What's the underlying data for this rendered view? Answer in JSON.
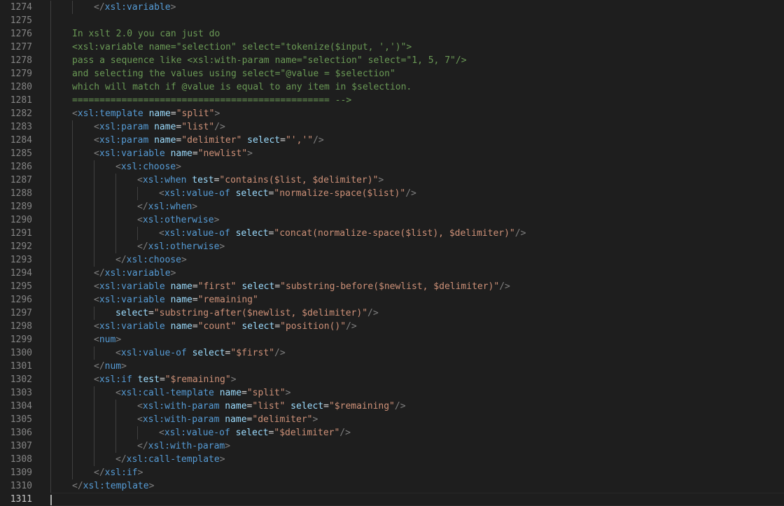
{
  "editor": {
    "lines": [
      {
        "n": "1274",
        "indent": 2,
        "tokens": [
          {
            "t": "</",
            "c": "bracket"
          },
          {
            "t": "xsl:variable",
            "c": "tag"
          },
          {
            "t": ">",
            "c": "bracket"
          }
        ]
      },
      {
        "n": "1275",
        "indent": 0,
        "tokens": []
      },
      {
        "n": "1276",
        "indent": 1,
        "tokens": [
          {
            "t": "In xslt 2.0 you can just do",
            "c": "comment"
          }
        ]
      },
      {
        "n": "1277",
        "indent": 1,
        "tokens": [
          {
            "t": "<xsl:variable name=\"selection\" select=\"tokenize($input, ',')\">",
            "c": "comment"
          }
        ]
      },
      {
        "n": "1278",
        "indent": 1,
        "tokens": [
          {
            "t": "pass a sequence like <xsl:with-param name=\"selection\" select=\"1, 5, 7\"/>",
            "c": "comment"
          }
        ]
      },
      {
        "n": "1279",
        "indent": 1,
        "tokens": [
          {
            "t": "and selecting the values using select=\"@value = $selection\"",
            "c": "comment"
          }
        ]
      },
      {
        "n": "1280",
        "indent": 1,
        "tokens": [
          {
            "t": "which will match if @value is equal to any item in $selection.",
            "c": "comment"
          }
        ]
      },
      {
        "n": "1281",
        "indent": 1,
        "tokens": [
          {
            "t": "=============================================== -->",
            "c": "comment"
          }
        ]
      },
      {
        "n": "1282",
        "indent": 1,
        "tokens": [
          {
            "t": "<",
            "c": "bracket"
          },
          {
            "t": "xsl:template",
            "c": "tag"
          },
          {
            "t": " ",
            "c": "text"
          },
          {
            "t": "name",
            "c": "attr"
          },
          {
            "t": "=",
            "c": "eq"
          },
          {
            "t": "\"split\"",
            "c": "str"
          },
          {
            "t": ">",
            "c": "bracket"
          }
        ]
      },
      {
        "n": "1283",
        "indent": 2,
        "tokens": [
          {
            "t": "<",
            "c": "bracket"
          },
          {
            "t": "xsl:param",
            "c": "tag"
          },
          {
            "t": " ",
            "c": "text"
          },
          {
            "t": "name",
            "c": "attr"
          },
          {
            "t": "=",
            "c": "eq"
          },
          {
            "t": "\"list\"",
            "c": "str"
          },
          {
            "t": "/>",
            "c": "bracket"
          }
        ]
      },
      {
        "n": "1284",
        "indent": 2,
        "tokens": [
          {
            "t": "<",
            "c": "bracket"
          },
          {
            "t": "xsl:param",
            "c": "tag"
          },
          {
            "t": " ",
            "c": "text"
          },
          {
            "t": "name",
            "c": "attr"
          },
          {
            "t": "=",
            "c": "eq"
          },
          {
            "t": "\"delimiter\"",
            "c": "str"
          },
          {
            "t": " ",
            "c": "text"
          },
          {
            "t": "select",
            "c": "attr"
          },
          {
            "t": "=",
            "c": "eq"
          },
          {
            "t": "\"','\"",
            "c": "str"
          },
          {
            "t": "/>",
            "c": "bracket"
          }
        ]
      },
      {
        "n": "1285",
        "indent": 2,
        "tokens": [
          {
            "t": "<",
            "c": "bracket"
          },
          {
            "t": "xsl:variable",
            "c": "tag"
          },
          {
            "t": " ",
            "c": "text"
          },
          {
            "t": "name",
            "c": "attr"
          },
          {
            "t": "=",
            "c": "eq"
          },
          {
            "t": "\"newlist\"",
            "c": "str"
          },
          {
            "t": ">",
            "c": "bracket"
          }
        ]
      },
      {
        "n": "1286",
        "indent": 3,
        "tokens": [
          {
            "t": "<",
            "c": "bracket"
          },
          {
            "t": "xsl:choose",
            "c": "tag"
          },
          {
            "t": ">",
            "c": "bracket"
          }
        ]
      },
      {
        "n": "1287",
        "indent": 4,
        "tokens": [
          {
            "t": "<",
            "c": "bracket"
          },
          {
            "t": "xsl:when",
            "c": "tag"
          },
          {
            "t": " ",
            "c": "text"
          },
          {
            "t": "test",
            "c": "attr"
          },
          {
            "t": "=",
            "c": "eq"
          },
          {
            "t": "\"contains($list, $delimiter)\"",
            "c": "str"
          },
          {
            "t": ">",
            "c": "bracket"
          }
        ]
      },
      {
        "n": "1288",
        "indent": 5,
        "tokens": [
          {
            "t": "<",
            "c": "bracket"
          },
          {
            "t": "xsl:value-of",
            "c": "tag"
          },
          {
            "t": " ",
            "c": "text"
          },
          {
            "t": "select",
            "c": "attr"
          },
          {
            "t": "=",
            "c": "eq"
          },
          {
            "t": "\"normalize-space($list)\"",
            "c": "str"
          },
          {
            "t": "/>",
            "c": "bracket"
          }
        ]
      },
      {
        "n": "1289",
        "indent": 4,
        "tokens": [
          {
            "t": "</",
            "c": "bracket"
          },
          {
            "t": "xsl:when",
            "c": "tag"
          },
          {
            "t": ">",
            "c": "bracket"
          }
        ]
      },
      {
        "n": "1290",
        "indent": 4,
        "tokens": [
          {
            "t": "<",
            "c": "bracket"
          },
          {
            "t": "xsl:otherwise",
            "c": "tag"
          },
          {
            "t": ">",
            "c": "bracket"
          }
        ]
      },
      {
        "n": "1291",
        "indent": 5,
        "tokens": [
          {
            "t": "<",
            "c": "bracket"
          },
          {
            "t": "xsl:value-of",
            "c": "tag"
          },
          {
            "t": " ",
            "c": "text"
          },
          {
            "t": "select",
            "c": "attr"
          },
          {
            "t": "=",
            "c": "eq"
          },
          {
            "t": "\"concat(normalize-space($list), $delimiter)\"",
            "c": "str"
          },
          {
            "t": "/>",
            "c": "bracket"
          }
        ]
      },
      {
        "n": "1292",
        "indent": 4,
        "tokens": [
          {
            "t": "</",
            "c": "bracket"
          },
          {
            "t": "xsl:otherwise",
            "c": "tag"
          },
          {
            "t": ">",
            "c": "bracket"
          }
        ]
      },
      {
        "n": "1293",
        "indent": 3,
        "tokens": [
          {
            "t": "</",
            "c": "bracket"
          },
          {
            "t": "xsl:choose",
            "c": "tag"
          },
          {
            "t": ">",
            "c": "bracket"
          }
        ]
      },
      {
        "n": "1294",
        "indent": 2,
        "tokens": [
          {
            "t": "</",
            "c": "bracket"
          },
          {
            "t": "xsl:variable",
            "c": "tag"
          },
          {
            "t": ">",
            "c": "bracket"
          }
        ]
      },
      {
        "n": "1295",
        "indent": 2,
        "tokens": [
          {
            "t": "<",
            "c": "bracket"
          },
          {
            "t": "xsl:variable",
            "c": "tag"
          },
          {
            "t": " ",
            "c": "text"
          },
          {
            "t": "name",
            "c": "attr"
          },
          {
            "t": "=",
            "c": "eq"
          },
          {
            "t": "\"first\"",
            "c": "str"
          },
          {
            "t": " ",
            "c": "text"
          },
          {
            "t": "select",
            "c": "attr"
          },
          {
            "t": "=",
            "c": "eq"
          },
          {
            "t": "\"substring-before($newlist, $delimiter)\"",
            "c": "str"
          },
          {
            "t": "/>",
            "c": "bracket"
          }
        ]
      },
      {
        "n": "1296",
        "indent": 2,
        "tokens": [
          {
            "t": "<",
            "c": "bracket"
          },
          {
            "t": "xsl:variable",
            "c": "tag"
          },
          {
            "t": " ",
            "c": "text"
          },
          {
            "t": "name",
            "c": "attr"
          },
          {
            "t": "=",
            "c": "eq"
          },
          {
            "t": "\"remaining\"",
            "c": "str"
          }
        ]
      },
      {
        "n": "1297",
        "indent": 3,
        "tokens": [
          {
            "t": "select",
            "c": "attr"
          },
          {
            "t": "=",
            "c": "eq"
          },
          {
            "t": "\"substring-after($newlist, $delimiter)\"",
            "c": "str"
          },
          {
            "t": "/>",
            "c": "bracket"
          }
        ]
      },
      {
        "n": "1298",
        "indent": 2,
        "tokens": [
          {
            "t": "<",
            "c": "bracket"
          },
          {
            "t": "xsl:variable",
            "c": "tag"
          },
          {
            "t": " ",
            "c": "text"
          },
          {
            "t": "name",
            "c": "attr"
          },
          {
            "t": "=",
            "c": "eq"
          },
          {
            "t": "\"count\"",
            "c": "str"
          },
          {
            "t": " ",
            "c": "text"
          },
          {
            "t": "select",
            "c": "attr"
          },
          {
            "t": "=",
            "c": "eq"
          },
          {
            "t": "\"position()\"",
            "c": "str"
          },
          {
            "t": "/>",
            "c": "bracket"
          }
        ]
      },
      {
        "n": "1299",
        "indent": 2,
        "tokens": [
          {
            "t": "<",
            "c": "bracket"
          },
          {
            "t": "num",
            "c": "tag"
          },
          {
            "t": ">",
            "c": "bracket"
          }
        ]
      },
      {
        "n": "1300",
        "indent": 3,
        "tokens": [
          {
            "t": "<",
            "c": "bracket"
          },
          {
            "t": "xsl:value-of",
            "c": "tag"
          },
          {
            "t": " ",
            "c": "text"
          },
          {
            "t": "select",
            "c": "attr"
          },
          {
            "t": "=",
            "c": "eq"
          },
          {
            "t": "\"$first\"",
            "c": "str"
          },
          {
            "t": "/>",
            "c": "bracket"
          }
        ]
      },
      {
        "n": "1301",
        "indent": 2,
        "tokens": [
          {
            "t": "</",
            "c": "bracket"
          },
          {
            "t": "num",
            "c": "tag"
          },
          {
            "t": ">",
            "c": "bracket"
          }
        ]
      },
      {
        "n": "1302",
        "indent": 2,
        "tokens": [
          {
            "t": "<",
            "c": "bracket"
          },
          {
            "t": "xsl:if",
            "c": "tag"
          },
          {
            "t": " ",
            "c": "text"
          },
          {
            "t": "test",
            "c": "attr"
          },
          {
            "t": "=",
            "c": "eq"
          },
          {
            "t": "\"$remaining\"",
            "c": "str"
          },
          {
            "t": ">",
            "c": "bracket"
          }
        ]
      },
      {
        "n": "1303",
        "indent": 3,
        "tokens": [
          {
            "t": "<",
            "c": "bracket"
          },
          {
            "t": "xsl:call-template",
            "c": "tag"
          },
          {
            "t": " ",
            "c": "text"
          },
          {
            "t": "name",
            "c": "attr"
          },
          {
            "t": "=",
            "c": "eq"
          },
          {
            "t": "\"split\"",
            "c": "str"
          },
          {
            "t": ">",
            "c": "bracket"
          }
        ]
      },
      {
        "n": "1304",
        "indent": 4,
        "tokens": [
          {
            "t": "<",
            "c": "bracket"
          },
          {
            "t": "xsl:with-param",
            "c": "tag"
          },
          {
            "t": " ",
            "c": "text"
          },
          {
            "t": "name",
            "c": "attr"
          },
          {
            "t": "=",
            "c": "eq"
          },
          {
            "t": "\"list\"",
            "c": "str"
          },
          {
            "t": " ",
            "c": "text"
          },
          {
            "t": "select",
            "c": "attr"
          },
          {
            "t": "=",
            "c": "eq"
          },
          {
            "t": "\"$remaining\"",
            "c": "str"
          },
          {
            "t": "/>",
            "c": "bracket"
          }
        ]
      },
      {
        "n": "1305",
        "indent": 4,
        "tokens": [
          {
            "t": "<",
            "c": "bracket"
          },
          {
            "t": "xsl:with-param",
            "c": "tag"
          },
          {
            "t": " ",
            "c": "text"
          },
          {
            "t": "name",
            "c": "attr"
          },
          {
            "t": "=",
            "c": "eq"
          },
          {
            "t": "\"delimiter\"",
            "c": "str"
          },
          {
            "t": ">",
            "c": "bracket"
          }
        ]
      },
      {
        "n": "1306",
        "indent": 5,
        "tokens": [
          {
            "t": "<",
            "c": "bracket"
          },
          {
            "t": "xsl:value-of",
            "c": "tag"
          },
          {
            "t": " ",
            "c": "text"
          },
          {
            "t": "select",
            "c": "attr"
          },
          {
            "t": "=",
            "c": "eq"
          },
          {
            "t": "\"$delimiter\"",
            "c": "str"
          },
          {
            "t": "/>",
            "c": "bracket"
          }
        ]
      },
      {
        "n": "1307",
        "indent": 4,
        "tokens": [
          {
            "t": "</",
            "c": "bracket"
          },
          {
            "t": "xsl:with-param",
            "c": "tag"
          },
          {
            "t": ">",
            "c": "bracket"
          }
        ]
      },
      {
        "n": "1308",
        "indent": 3,
        "tokens": [
          {
            "t": "</",
            "c": "bracket"
          },
          {
            "t": "xsl:call-template",
            "c": "tag"
          },
          {
            "t": ">",
            "c": "bracket"
          }
        ]
      },
      {
        "n": "1309",
        "indent": 2,
        "tokens": [
          {
            "t": "</",
            "c": "bracket"
          },
          {
            "t": "xsl:if",
            "c": "tag"
          },
          {
            "t": ">",
            "c": "bracket"
          }
        ]
      },
      {
        "n": "1310",
        "indent": 1,
        "tokens": [
          {
            "t": "</",
            "c": "bracket"
          },
          {
            "t": "xsl:template",
            "c": "tag"
          },
          {
            "t": ">",
            "c": "bracket"
          }
        ]
      },
      {
        "n": "1311",
        "indent": 0,
        "tokens": [],
        "current": true
      }
    ]
  },
  "colors": {
    "background": "#1e1e1e",
    "line_number": "#858585",
    "line_number_active": "#c6c6c6",
    "comment": "#6a9955",
    "tag": "#569cd6",
    "bracket": "#808080",
    "attribute": "#9cdcfe",
    "string": "#ce9178"
  }
}
